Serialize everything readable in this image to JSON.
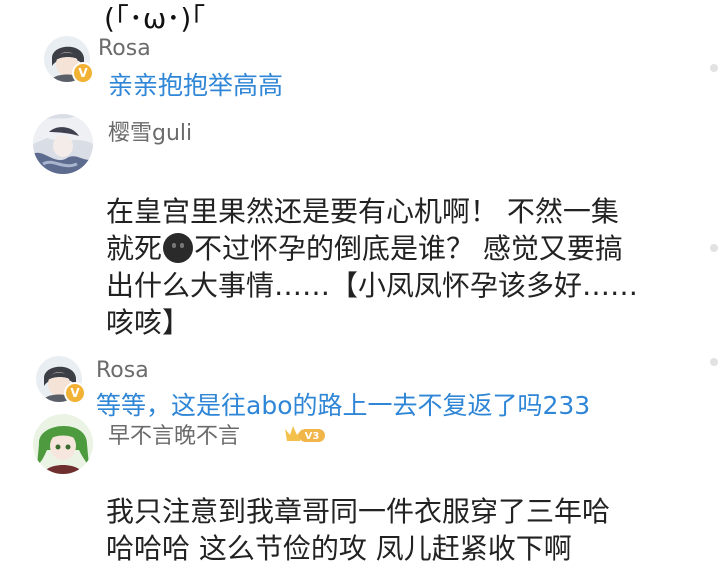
{
  "top_text": "(｢･ω･)｢",
  "comments": [
    {
      "user": "Rosa",
      "reply": "亲亲抱抱举高高",
      "badge": "V"
    },
    {
      "user": "樱雪guli",
      "line1": "在皇宫里果然还是要有心机啊！ 不然一集",
      "line2_a": "就死",
      "line2_b": "不过怀孕的倒底是谁？ 感觉又要搞",
      "line3": "出什么大事情……【小凤凤怀孕该多好……",
      "line4": "咳咳】"
    },
    {
      "user": "Rosa",
      "reply": "等等，这是往abo的路上一去不复返了吗233",
      "badge": "V"
    },
    {
      "user": "早不言晚不言",
      "level": "V3",
      "line1": "我只注意到我章哥同一件衣服穿了三年哈",
      "line2": "哈哈哈 这么节俭的攻  凤儿赶紧收下啊"
    }
  ],
  "icons": [
    "v-verified-icon",
    "black-face-emoji-icon",
    "crown-level-icon"
  ]
}
